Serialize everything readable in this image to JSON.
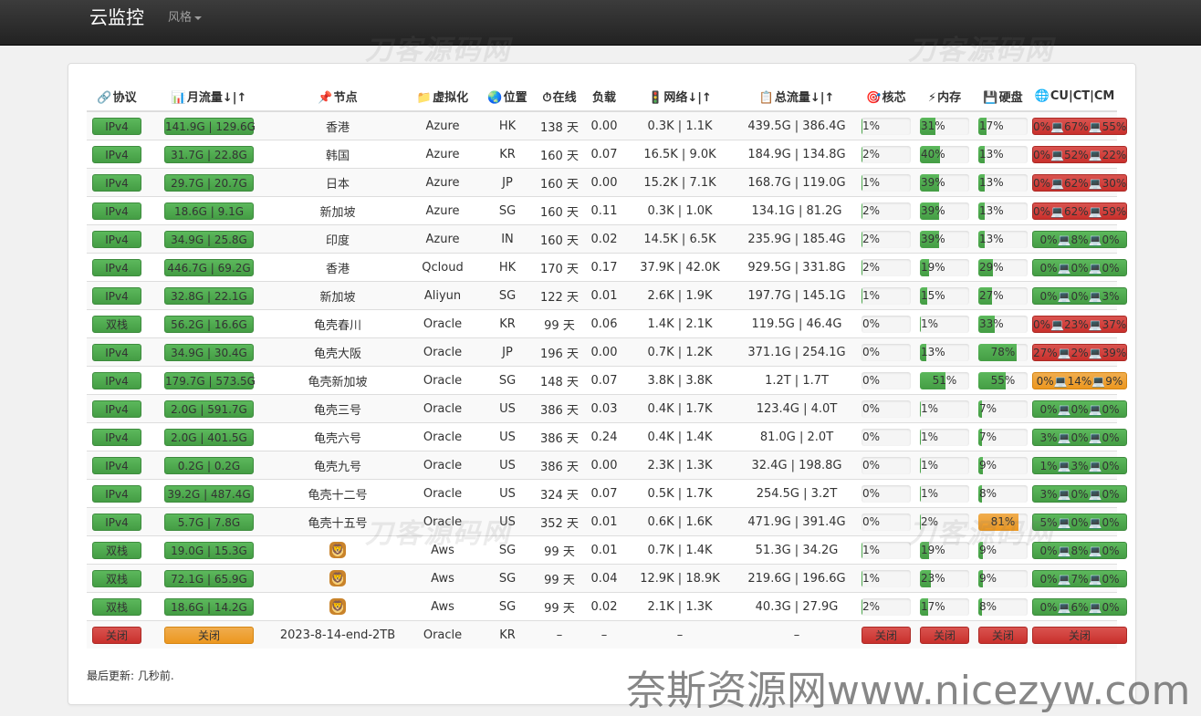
{
  "nav": {
    "brand": "云监控",
    "style_menu": "风格"
  },
  "watermarks": {
    "repeat": "刀客源码网",
    "site": "奈斯资源网www.nicezyw.com"
  },
  "headers": [
    {
      "icon": "link-icon",
      "glyph": "🔗",
      "label": "协议"
    },
    {
      "icon": "bar-chart-icon",
      "glyph": "📊",
      "label": "月流量↓|↑"
    },
    {
      "icon": "pushpin-icon",
      "glyph": "📌",
      "label": "节点"
    },
    {
      "icon": "folder-icon",
      "glyph": "📁",
      "label": "虚拟化"
    },
    {
      "icon": "globe-icon",
      "glyph": "🌏",
      "label": "位置"
    },
    {
      "icon": "stopwatch-icon",
      "glyph": "⏱",
      "label": "在线"
    },
    {
      "icon": "none",
      "glyph": "",
      "label": "负载"
    },
    {
      "icon": "traffic-light-icon",
      "glyph": "🚦",
      "label": "网络↓|↑"
    },
    {
      "icon": "clipboard-icon",
      "glyph": "📋",
      "label": "总流量↓|↑"
    },
    {
      "icon": "target-icon",
      "glyph": "🎯",
      "label": "核芯"
    },
    {
      "icon": "lightning-icon",
      "glyph": "⚡",
      "label": "内存"
    },
    {
      "icon": "floppy-disk-icon",
      "glyph": "💾",
      "label": "硬盘"
    },
    {
      "icon": "globe-network-icon",
      "glyph": "🌐",
      "label": "CU|CT|CM"
    }
  ],
  "rows": [
    {
      "proto": "IPv4",
      "month": "141.9G | 129.6G",
      "node": "香港",
      "virt": "Azure",
      "loc": "HK",
      "uptime": "138 天",
      "load": "0.00",
      "net": "0.3K | 1.1K",
      "total": "439.5G | 386.4G",
      "cpu": 1,
      "mem": 31,
      "hdd": 17,
      "isp": "0%💻67%💻55%",
      "isp_color": "red"
    },
    {
      "proto": "IPv4",
      "month": "31.7G | 22.8G",
      "node": "韩国",
      "virt": "Azure",
      "loc": "KR",
      "uptime": "160 天",
      "load": "0.07",
      "net": "16.5K | 9.0K",
      "total": "184.9G | 134.8G",
      "cpu": 2,
      "mem": 40,
      "hdd": 13,
      "isp": "0%💻52%💻22%",
      "isp_color": "red"
    },
    {
      "proto": "IPv4",
      "month": "29.7G | 20.7G",
      "node": "日本",
      "virt": "Azure",
      "loc": "JP",
      "uptime": "160 天",
      "load": "0.00",
      "net": "15.2K | 7.1K",
      "total": "168.7G | 119.0G",
      "cpu": 1,
      "mem": 39,
      "hdd": 13,
      "isp": "0%💻62%💻30%",
      "isp_color": "red"
    },
    {
      "proto": "IPv4",
      "month": "18.6G | 9.1G",
      "node": "新加坡",
      "virt": "Azure",
      "loc": "SG",
      "uptime": "160 天",
      "load": "0.11",
      "net": "0.3K | 1.0K",
      "total": "134.1G | 81.2G",
      "cpu": 2,
      "mem": 39,
      "hdd": 13,
      "isp": "0%💻62%💻59%",
      "isp_color": "red"
    },
    {
      "proto": "IPv4",
      "month": "34.9G | 25.8G",
      "node": "印度",
      "virt": "Azure",
      "loc": "IN",
      "uptime": "160 天",
      "load": "0.02",
      "net": "14.5K | 6.5K",
      "total": "235.9G | 185.4G",
      "cpu": 2,
      "mem": 39,
      "hdd": 13,
      "isp": "0%💻8%💻0%",
      "isp_color": "green"
    },
    {
      "proto": "IPv4",
      "month": "446.7G | 69.2G",
      "node": "香港",
      "virt": "Qcloud",
      "loc": "HK",
      "uptime": "170 天",
      "load": "0.17",
      "net": "37.9K | 42.0K",
      "total": "929.5G | 331.8G",
      "cpu": 2,
      "mem": 19,
      "hdd": 29,
      "isp": "0%💻0%💻0%",
      "isp_color": "green"
    },
    {
      "proto": "IPv4",
      "month": "32.8G | 22.1G",
      "node": "新加坡",
      "virt": "Aliyun",
      "loc": "SG",
      "uptime": "122 天",
      "load": "0.01",
      "net": "2.6K | 1.9K",
      "total": "197.7G | 145.1G",
      "cpu": 1,
      "mem": 15,
      "hdd": 27,
      "isp": "0%💻0%💻3%",
      "isp_color": "green"
    },
    {
      "proto": "双栈",
      "month": "56.2G | 16.6G",
      "node": "龟壳春川",
      "virt": "Oracle",
      "loc": "KR",
      "uptime": "99 天",
      "load": "0.06",
      "net": "1.4K | 2.1K",
      "total": "119.5G | 46.4G",
      "cpu": 0,
      "mem": 1,
      "hdd": 33,
      "isp": "0%💻23%💻37%",
      "isp_color": "red"
    },
    {
      "proto": "IPv4",
      "month": "34.9G | 30.4G",
      "node": "龟壳大阪",
      "virt": "Oracle",
      "loc": "JP",
      "uptime": "196 天",
      "load": "0.00",
      "net": "0.7K | 1.2K",
      "total": "371.1G | 254.1G",
      "cpu": 0,
      "mem": 13,
      "hdd": 78,
      "isp": "27%💻2%💻39%",
      "isp_color": "red"
    },
    {
      "proto": "IPv4",
      "month": "179.7G | 573.5G",
      "node": "龟壳新加坡",
      "virt": "Oracle",
      "loc": "SG",
      "uptime": "148 天",
      "load": "0.07",
      "net": "3.8K | 3.8K",
      "total": "1.2T | 1.7T",
      "cpu": 0,
      "mem": 51,
      "hdd": 55,
      "isp": "0%💻14%💻9%",
      "isp_color": "orange"
    },
    {
      "proto": "IPv4",
      "month": "2.0G | 591.7G",
      "node": "龟壳三号",
      "virt": "Oracle",
      "loc": "US",
      "uptime": "386 天",
      "load": "0.03",
      "net": "0.4K | 1.7K",
      "total": "123.4G | 4.0T",
      "cpu": 0,
      "mem": 1,
      "hdd": 7,
      "isp": "0%💻0%💻0%",
      "isp_color": "green"
    },
    {
      "proto": "IPv4",
      "month": "2.0G | 401.5G",
      "node": "龟壳六号",
      "virt": "Oracle",
      "loc": "US",
      "uptime": "386 天",
      "load": "0.24",
      "net": "0.4K | 1.4K",
      "total": "81.0G | 2.0T",
      "cpu": 0,
      "mem": 1,
      "hdd": 7,
      "isp": "3%💻0%💻0%",
      "isp_color": "green"
    },
    {
      "proto": "IPv4",
      "month": "0.2G | 0.2G",
      "node": "龟壳九号",
      "virt": "Oracle",
      "loc": "US",
      "uptime": "386 天",
      "load": "0.00",
      "net": "2.3K | 1.3K",
      "total": "32.4G | 198.8G",
      "cpu": 0,
      "mem": 1,
      "hdd": 9,
      "isp": "1%💻3%💻0%",
      "isp_color": "green"
    },
    {
      "proto": "IPv4",
      "month": "39.2G | 487.4G",
      "node": "龟壳十二号",
      "virt": "Oracle",
      "loc": "US",
      "uptime": "324 天",
      "load": "0.07",
      "net": "0.5K | 1.7K",
      "total": "254.5G | 3.2T",
      "cpu": 0,
      "mem": 1,
      "hdd": 8,
      "isp": "3%💻0%💻0%",
      "isp_color": "green"
    },
    {
      "proto": "IPv4",
      "month": "5.7G | 7.8G",
      "node": "龟壳十五号",
      "virt": "Oracle",
      "loc": "US",
      "uptime": "352 天",
      "load": "0.01",
      "net": "0.6K | 1.6K",
      "total": "471.9G | 391.4G",
      "cpu": 0,
      "mem": 2,
      "hdd": 81,
      "isp": "5%💻0%💻0%",
      "isp_color": "green"
    },
    {
      "proto": "双栈",
      "month": "19.0G | 15.3G",
      "node": "",
      "virt": "Aws",
      "loc": "SG",
      "uptime": "99 天",
      "load": "0.01",
      "net": "0.7K | 1.4K",
      "total": "51.3G | 34.2G",
      "cpu": 1,
      "mem": 19,
      "hdd": 9,
      "isp": "0%💻8%💻0%",
      "isp_color": "green",
      "lion": true
    },
    {
      "proto": "双栈",
      "month": "72.1G | 65.9G",
      "node": "",
      "virt": "Aws",
      "loc": "SG",
      "uptime": "99 天",
      "load": "0.04",
      "net": "12.9K | 18.9K",
      "total": "219.6G | 196.6G",
      "cpu": 1,
      "mem": 23,
      "hdd": 9,
      "isp": "0%💻7%💻0%",
      "isp_color": "green",
      "lion": true
    },
    {
      "proto": "双栈",
      "month": "18.6G | 14.2G",
      "node": "",
      "virt": "Aws",
      "loc": "SG",
      "uptime": "99 天",
      "load": "0.02",
      "net": "2.1K | 1.3K",
      "total": "40.3G | 27.9G",
      "cpu": 2,
      "mem": 17,
      "hdd": 8,
      "isp": "0%💻6%💻0%",
      "isp_color": "green",
      "lion": true
    }
  ],
  "offline_row": {
    "proto": "关闭",
    "month": "关闭",
    "node": "2023-8-14-end-2TB",
    "virt": "Oracle",
    "loc": "KR",
    "uptime": "–",
    "load": "–",
    "net": "–",
    "total": "–",
    "cpu": "关闭",
    "mem": "关闭",
    "hdd": "关闭",
    "isp": "关闭"
  },
  "footer": {
    "last_update": "最后更新: 几秒前."
  },
  "colors": {
    "green": "#5cb85c",
    "red": "#d9534f",
    "orange": "#f0ad4e"
  }
}
